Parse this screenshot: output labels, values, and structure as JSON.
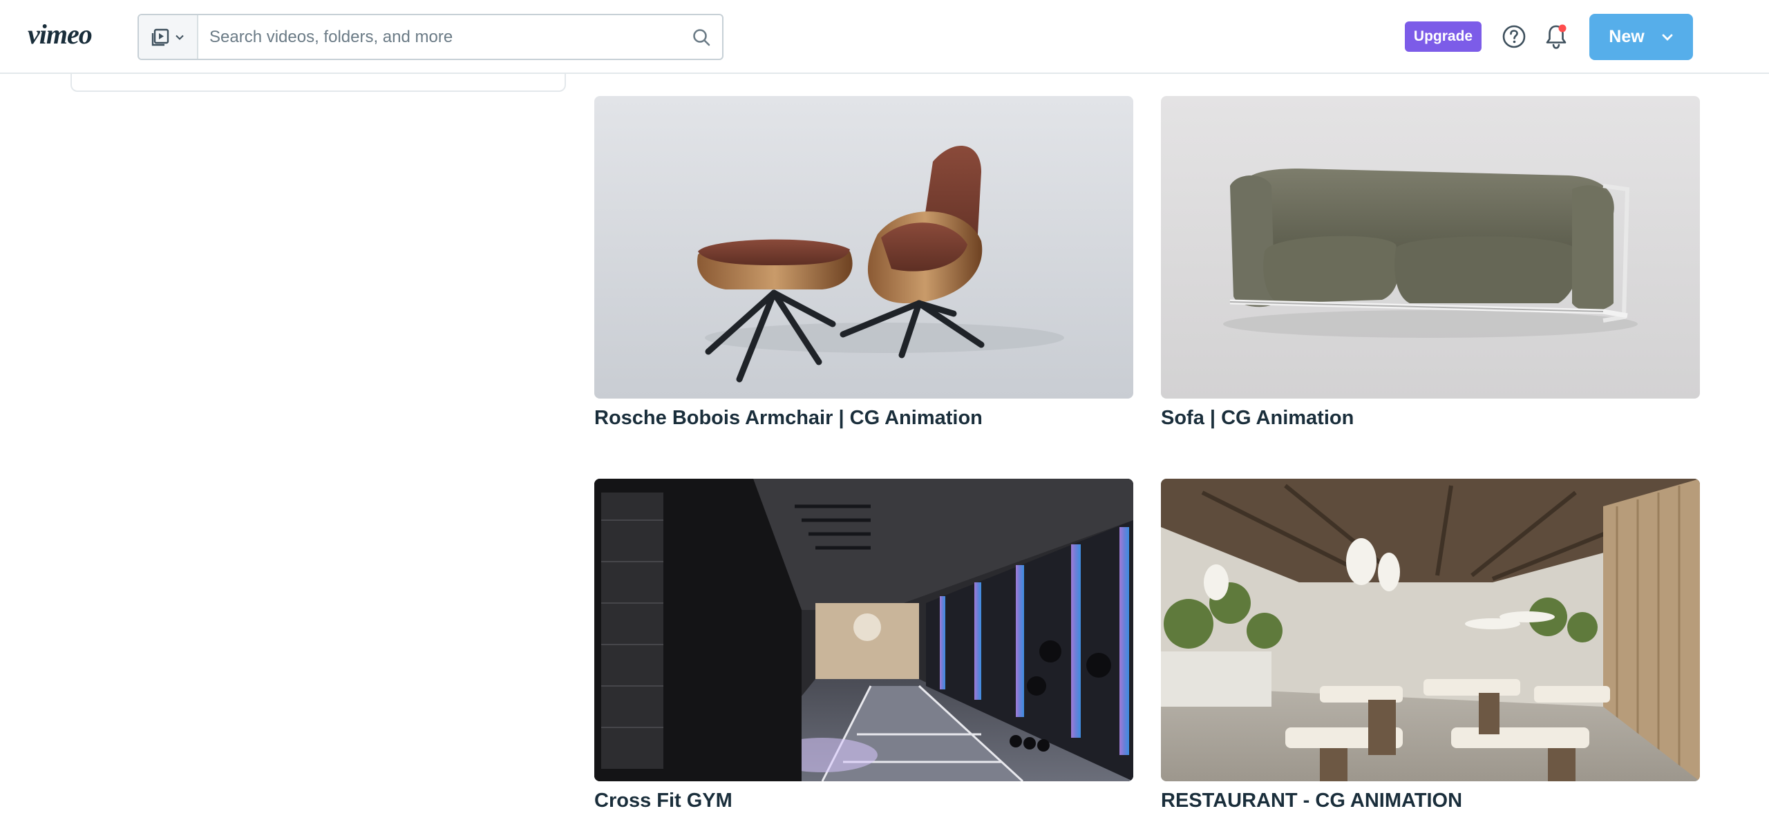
{
  "brand": {
    "logo_text": "vimeo",
    "accent": "#56aeea",
    "upgrade_color": "#7c5ce8"
  },
  "header": {
    "search": {
      "placeholder": "Search videos, folders, and more",
      "value": "",
      "filter_icon": "video-library-icon"
    },
    "upgrade_label": "Upgrade",
    "help_icon": "help-circle-icon",
    "notifications_icon": "bell-icon",
    "notifications_unread": true,
    "new_label": "New"
  },
  "videos": [
    {
      "title": "Rosche Bobois Armchair | CG Animation"
    },
    {
      "title": "Sofa | CG Animation"
    },
    {
      "title": "Cross Fit GYM"
    },
    {
      "title": "RESTAURANT - CG ANIMATION"
    }
  ]
}
